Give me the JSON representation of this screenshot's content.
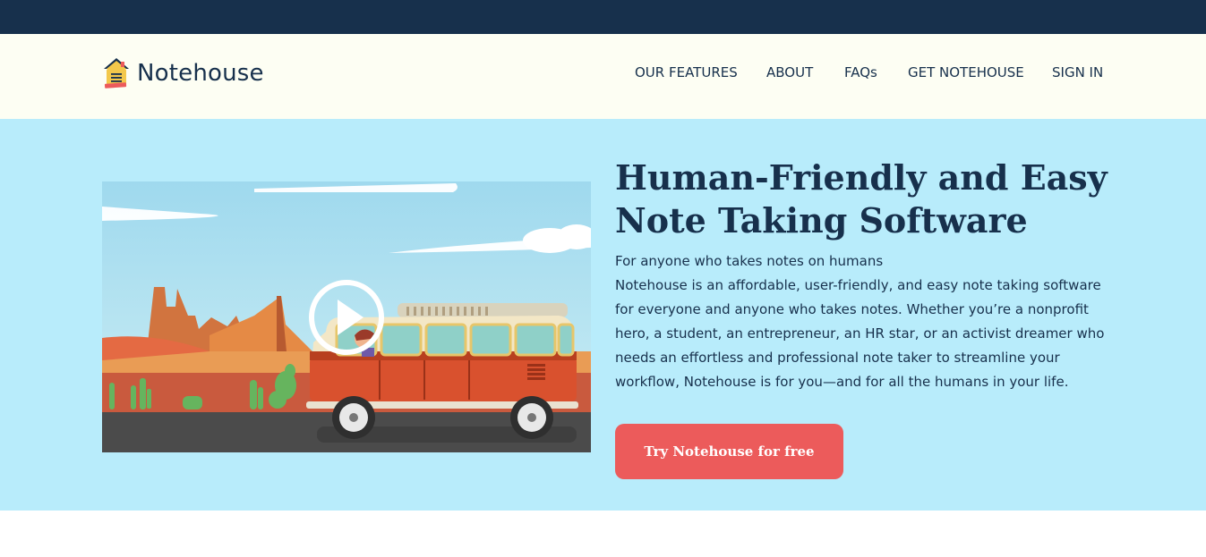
{
  "brand": {
    "name": "Notehouse"
  },
  "nav": {
    "items": [
      {
        "label": "OUR FEATURES"
      },
      {
        "label": "ABOUT"
      },
      {
        "label": "FAQs"
      },
      {
        "label": "GET NOTEHOUSE"
      },
      {
        "label": "SIGN IN"
      }
    ]
  },
  "hero": {
    "title": "Human-Friendly and Easy Note Taking Software",
    "subtitle": "For anyone who takes notes on humans",
    "body": "Notehouse is an affordable, user-friendly, and easy note taking software for everyone and anyone who takes notes. Whether you’re a nonprofit hero, a student, an entrepreneur, an HR star, or an activist dreamer who needs an effortless and professional note taker to streamline your workflow, Notehouse is for you—and for all the humans in your life.",
    "cta_label": "Try Notehouse for free",
    "video_icon": "play-icon"
  },
  "colors": {
    "topbar": "#17304c",
    "navbar": "#fdfef3",
    "hero": "#b8ecfb",
    "text": "#17304c",
    "cta": "#ec5b5b"
  }
}
